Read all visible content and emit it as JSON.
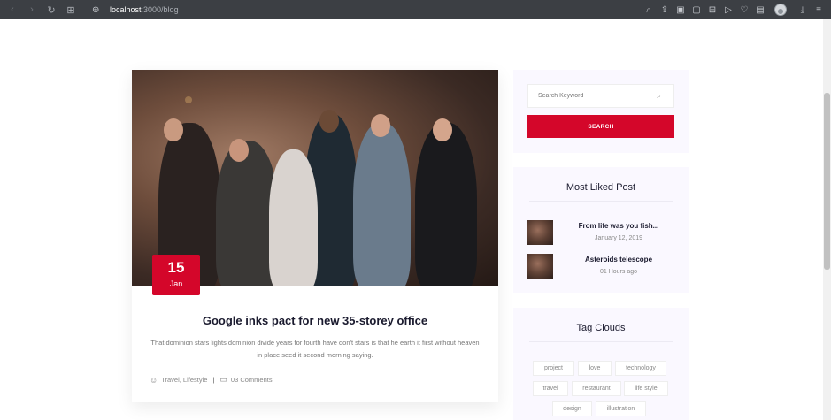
{
  "browser": {
    "url_host": "localhost",
    "url_rest": ":3000/blog"
  },
  "post": {
    "date_day": "15",
    "date_month": "Jan",
    "title": "Google inks pact for new 35-storey office",
    "excerpt": "That dominion stars lights dominion divide years for fourth have don't stars is that he earth it first without heaven in place seed it second morning saying.",
    "categories": "Travel, Lifestyle",
    "comments": "03 Comments"
  },
  "sidebar": {
    "search": {
      "placeholder": "Search Keyword",
      "button_label": "SEARCH"
    },
    "most_liked": {
      "title": "Most Liked Post",
      "items": [
        {
          "title": "From life was you fish...",
          "date": "January 12, 2019"
        },
        {
          "title": "Asteroids telescope",
          "date": "01 Hours ago"
        }
      ]
    },
    "tags": {
      "title": "Tag Clouds",
      "items": [
        "project",
        "love",
        "technology",
        "travel",
        "restaurant",
        "life style",
        "design",
        "illustration"
      ]
    }
  },
  "colors": {
    "accent": "#d4062a",
    "widget_bg": "#faf8ff"
  }
}
